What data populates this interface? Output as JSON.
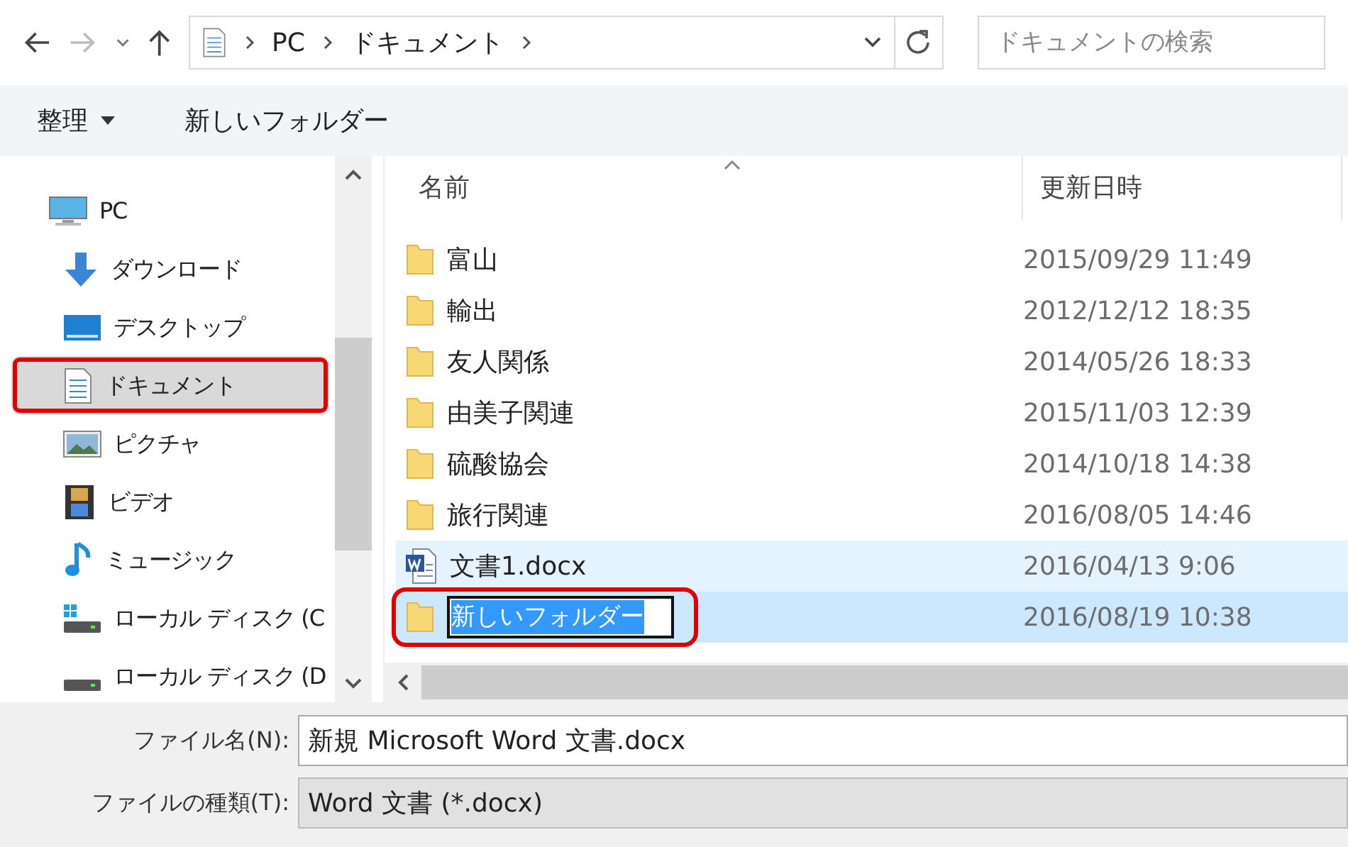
{
  "address_bar": {
    "breadcrumbs": [
      "PC",
      "ドキュメント"
    ],
    "search": {
      "placeholder": "ドキュメントの検索"
    }
  },
  "toolbar": {
    "organize": "整理",
    "new_folder": "新しいフォルダー"
  },
  "nav_pane": {
    "items": [
      {
        "label": "PC",
        "kind": "pc",
        "selected": false,
        "highlighted": false,
        "children": [
          {
            "label": "ダウンロード",
            "kind": "downloads",
            "selected": false,
            "highlighted": false
          },
          {
            "label": "デスクトップ",
            "kind": "desktop",
            "selected": false,
            "highlighted": false
          },
          {
            "label": "ドキュメント",
            "kind": "documents",
            "selected": true,
            "highlighted": true
          },
          {
            "label": "ピクチャ",
            "kind": "pictures",
            "selected": false,
            "highlighted": false
          },
          {
            "label": "ビデオ",
            "kind": "videos",
            "selected": false,
            "highlighted": false
          },
          {
            "label": "ミュージック",
            "kind": "music",
            "selected": false,
            "highlighted": false
          },
          {
            "label": "ローカル ディスク (C",
            "kind": "system-drive",
            "selected": false,
            "highlighted": false
          },
          {
            "label": "ローカル ディスク (D",
            "kind": "drive",
            "selected": false,
            "highlighted": false
          }
        ]
      }
    ]
  },
  "file_list": {
    "columns": [
      "名前",
      "更新日時"
    ],
    "rows": [
      {
        "name": "富山",
        "date": "2015/09/29 11:49",
        "kind": "folder",
        "selected": false,
        "hovered": false,
        "editing": false,
        "highlighted": false
      },
      {
        "name": "輸出",
        "date": "2012/12/12 18:35",
        "kind": "folder",
        "selected": false,
        "hovered": false,
        "editing": false,
        "highlighted": false
      },
      {
        "name": "友人関係",
        "date": "2014/05/26 18:33",
        "kind": "folder",
        "selected": false,
        "hovered": false,
        "editing": false,
        "highlighted": false
      },
      {
        "name": "由美子関連",
        "date": "2015/11/03 12:39",
        "kind": "folder",
        "selected": false,
        "hovered": false,
        "editing": false,
        "highlighted": false
      },
      {
        "name": "硫酸協会",
        "date": "2014/10/18 14:38",
        "kind": "folder",
        "selected": false,
        "hovered": false,
        "editing": false,
        "highlighted": false
      },
      {
        "name": "旅行関連",
        "date": "2016/08/05 14:46",
        "kind": "folder",
        "selected": false,
        "hovered": false,
        "editing": false,
        "highlighted": false
      },
      {
        "name": "文書1.docx",
        "date": "2016/04/13 9:06",
        "kind": "word",
        "selected": false,
        "hovered": true,
        "editing": false,
        "highlighted": false
      },
      {
        "name": "新しいフォルダー",
        "date": "2016/08/19 10:38",
        "kind": "folder",
        "selected": true,
        "hovered": false,
        "editing": true,
        "highlighted": true
      }
    ]
  },
  "save_form": {
    "file_name": {
      "label": "ファイル名(N):",
      "value": "新規 Microsoft Word 文書.docx"
    },
    "file_type": {
      "label": "ファイルの種類(T):",
      "value": "Word 文書 (*.docx)"
    }
  }
}
